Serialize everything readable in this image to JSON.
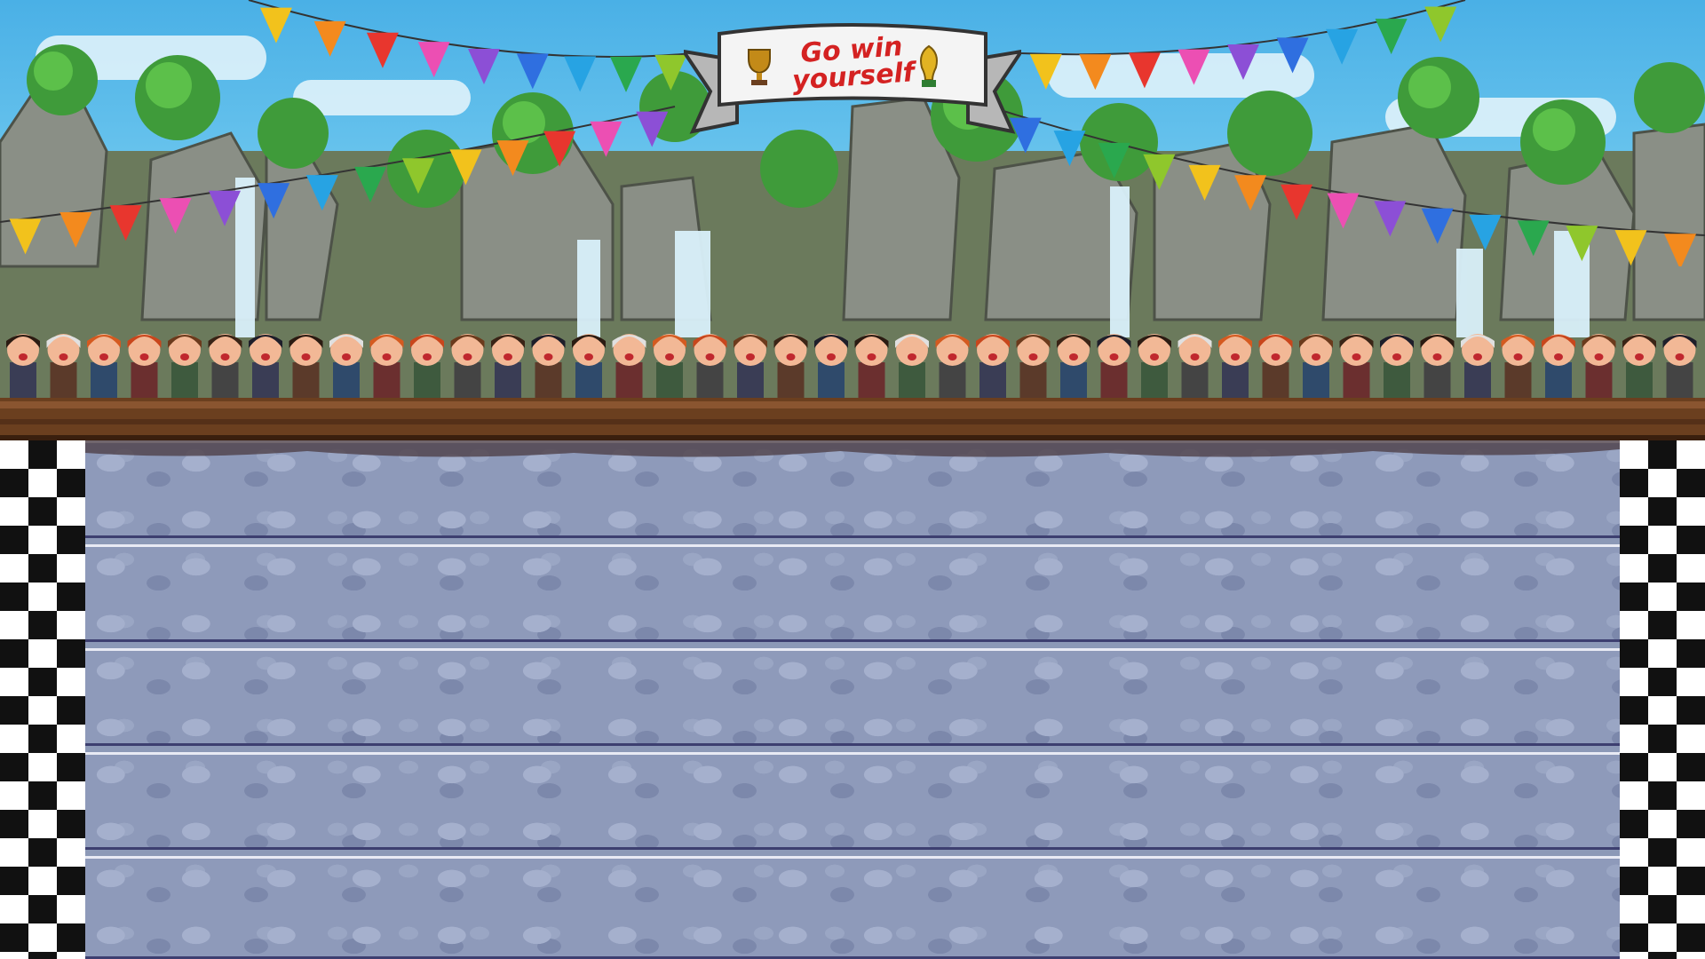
{
  "game": {
    "banner_text": "Go win yourself",
    "colors": {
      "sky": "#4ab0e6",
      "track": "#8e9aba",
      "lane_line_light": "#e8eaf4",
      "lane_line_dark": "#3d3f70",
      "fence": "#6b3f1f",
      "banner_text": "#d42222"
    },
    "flag_colors": [
      "#f2c21c",
      "#f38a1e",
      "#e8362e",
      "#ec4fb3",
      "#8c4fd6",
      "#2f6fe0",
      "#27a3e3",
      "#2aa84e",
      "#8fc72c"
    ],
    "lanes": 5,
    "icons": {
      "trophy_left": "trophy-icon",
      "trophy_right": "world-cup-trophy-icon",
      "finish_left": "checkered-flag-icon",
      "finish_right": "checkered-flag-icon"
    }
  }
}
